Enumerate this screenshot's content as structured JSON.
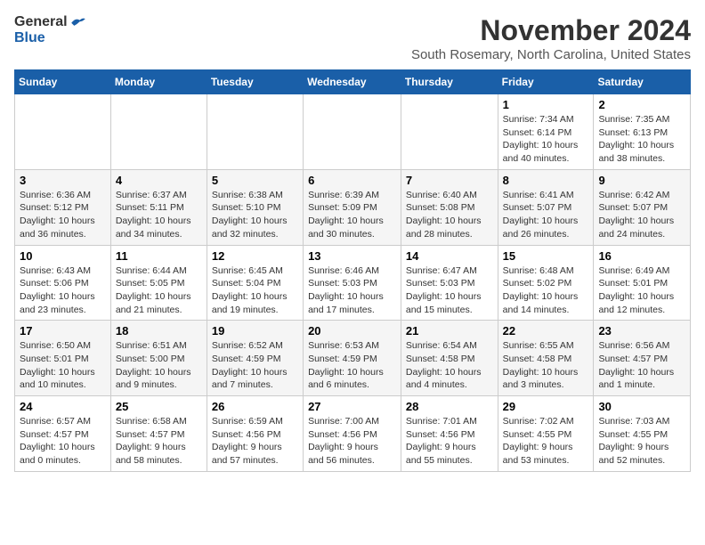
{
  "header": {
    "logo_general": "General",
    "logo_blue": "Blue",
    "month_title": "November 2024",
    "location": "South Rosemary, North Carolina, United States"
  },
  "weekdays": [
    "Sunday",
    "Monday",
    "Tuesday",
    "Wednesday",
    "Thursday",
    "Friday",
    "Saturday"
  ],
  "weeks": [
    [
      {
        "day": "",
        "info": ""
      },
      {
        "day": "",
        "info": ""
      },
      {
        "day": "",
        "info": ""
      },
      {
        "day": "",
        "info": ""
      },
      {
        "day": "",
        "info": ""
      },
      {
        "day": "1",
        "info": "Sunrise: 7:34 AM\nSunset: 6:14 PM\nDaylight: 10 hours\nand 40 minutes."
      },
      {
        "day": "2",
        "info": "Sunrise: 7:35 AM\nSunset: 6:13 PM\nDaylight: 10 hours\nand 38 minutes."
      }
    ],
    [
      {
        "day": "3",
        "info": "Sunrise: 6:36 AM\nSunset: 5:12 PM\nDaylight: 10 hours\nand 36 minutes."
      },
      {
        "day": "4",
        "info": "Sunrise: 6:37 AM\nSunset: 5:11 PM\nDaylight: 10 hours\nand 34 minutes."
      },
      {
        "day": "5",
        "info": "Sunrise: 6:38 AM\nSunset: 5:10 PM\nDaylight: 10 hours\nand 32 minutes."
      },
      {
        "day": "6",
        "info": "Sunrise: 6:39 AM\nSunset: 5:09 PM\nDaylight: 10 hours\nand 30 minutes."
      },
      {
        "day": "7",
        "info": "Sunrise: 6:40 AM\nSunset: 5:08 PM\nDaylight: 10 hours\nand 28 minutes."
      },
      {
        "day": "8",
        "info": "Sunrise: 6:41 AM\nSunset: 5:07 PM\nDaylight: 10 hours\nand 26 minutes."
      },
      {
        "day": "9",
        "info": "Sunrise: 6:42 AM\nSunset: 5:07 PM\nDaylight: 10 hours\nand 24 minutes."
      }
    ],
    [
      {
        "day": "10",
        "info": "Sunrise: 6:43 AM\nSunset: 5:06 PM\nDaylight: 10 hours\nand 23 minutes."
      },
      {
        "day": "11",
        "info": "Sunrise: 6:44 AM\nSunset: 5:05 PM\nDaylight: 10 hours\nand 21 minutes."
      },
      {
        "day": "12",
        "info": "Sunrise: 6:45 AM\nSunset: 5:04 PM\nDaylight: 10 hours\nand 19 minutes."
      },
      {
        "day": "13",
        "info": "Sunrise: 6:46 AM\nSunset: 5:03 PM\nDaylight: 10 hours\nand 17 minutes."
      },
      {
        "day": "14",
        "info": "Sunrise: 6:47 AM\nSunset: 5:03 PM\nDaylight: 10 hours\nand 15 minutes."
      },
      {
        "day": "15",
        "info": "Sunrise: 6:48 AM\nSunset: 5:02 PM\nDaylight: 10 hours\nand 14 minutes."
      },
      {
        "day": "16",
        "info": "Sunrise: 6:49 AM\nSunset: 5:01 PM\nDaylight: 10 hours\nand 12 minutes."
      }
    ],
    [
      {
        "day": "17",
        "info": "Sunrise: 6:50 AM\nSunset: 5:01 PM\nDaylight: 10 hours\nand 10 minutes."
      },
      {
        "day": "18",
        "info": "Sunrise: 6:51 AM\nSunset: 5:00 PM\nDaylight: 10 hours\nand 9 minutes."
      },
      {
        "day": "19",
        "info": "Sunrise: 6:52 AM\nSunset: 4:59 PM\nDaylight: 10 hours\nand 7 minutes."
      },
      {
        "day": "20",
        "info": "Sunrise: 6:53 AM\nSunset: 4:59 PM\nDaylight: 10 hours\nand 6 minutes."
      },
      {
        "day": "21",
        "info": "Sunrise: 6:54 AM\nSunset: 4:58 PM\nDaylight: 10 hours\nand 4 minutes."
      },
      {
        "day": "22",
        "info": "Sunrise: 6:55 AM\nSunset: 4:58 PM\nDaylight: 10 hours\nand 3 minutes."
      },
      {
        "day": "23",
        "info": "Sunrise: 6:56 AM\nSunset: 4:57 PM\nDaylight: 10 hours\nand 1 minute."
      }
    ],
    [
      {
        "day": "24",
        "info": "Sunrise: 6:57 AM\nSunset: 4:57 PM\nDaylight: 10 hours\nand 0 minutes."
      },
      {
        "day": "25",
        "info": "Sunrise: 6:58 AM\nSunset: 4:57 PM\nDaylight: 9 hours\nand 58 minutes."
      },
      {
        "day": "26",
        "info": "Sunrise: 6:59 AM\nSunset: 4:56 PM\nDaylight: 9 hours\nand 57 minutes."
      },
      {
        "day": "27",
        "info": "Sunrise: 7:00 AM\nSunset: 4:56 PM\nDaylight: 9 hours\nand 56 minutes."
      },
      {
        "day": "28",
        "info": "Sunrise: 7:01 AM\nSunset: 4:56 PM\nDaylight: 9 hours\nand 55 minutes."
      },
      {
        "day": "29",
        "info": "Sunrise: 7:02 AM\nSunset: 4:55 PM\nDaylight: 9 hours\nand 53 minutes."
      },
      {
        "day": "30",
        "info": "Sunrise: 7:03 AM\nSunset: 4:55 PM\nDaylight: 9 hours\nand 52 minutes."
      }
    ]
  ]
}
